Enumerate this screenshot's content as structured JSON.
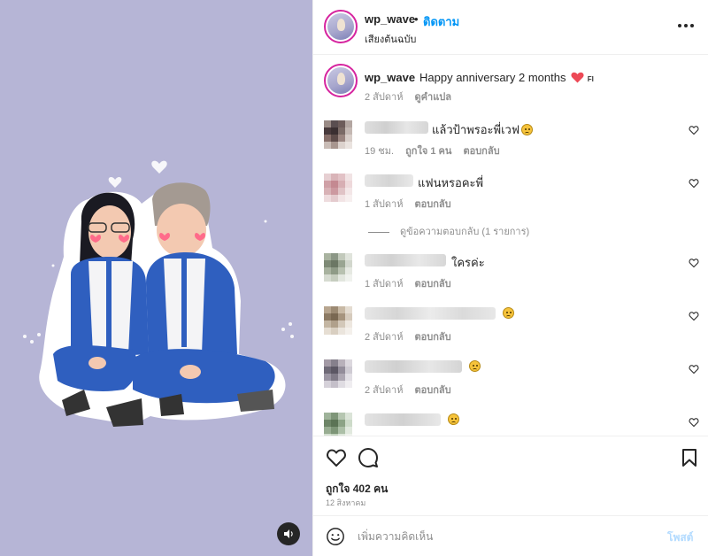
{
  "header": {
    "username": "wp_wave",
    "separator": "•",
    "follow_label": "ติดตาม",
    "sound_label": "เสียงต้นฉบับ",
    "more_icon": "more-horizontal-icon"
  },
  "caption": {
    "username": "wp_wave",
    "text": "Happy anniversary 2 months",
    "suffix": "FI",
    "time": "2 สัปดาห์",
    "translate_label": "ดูคำแปล"
  },
  "comments": [
    {
      "text": "แล้วป้าพรอะพี่เวฟ",
      "has_emoji": true,
      "time": "19 ชม.",
      "likes": "ถูกใจ 1 คน",
      "reply": "ตอบกลับ"
    },
    {
      "text": "แฟนหรอคะพี่",
      "has_emoji": false,
      "time": "1 สัปดาห์",
      "likes": "",
      "reply": "ตอบกลับ"
    },
    {
      "text": "ใครค่ะ",
      "has_emoji": false,
      "time": "1 สัปดาห์",
      "likes": "",
      "reply": "ตอบกลับ"
    },
    {
      "text": "",
      "has_emoji": true,
      "time": "2 สัปดาห์",
      "likes": "",
      "reply": "ตอบกลับ"
    },
    {
      "text": "",
      "has_emoji": true,
      "time": "2 สัปดาห์",
      "likes": "",
      "reply": "ตอบกลับ"
    },
    {
      "text": "",
      "has_emoji": true,
      "time": "",
      "likes": "",
      "reply": ""
    }
  ],
  "view_replies": "ดูข้อความตอบกลับ (1 รายการ)",
  "actions": {
    "likes_text": "ถูกใจ 402 คน",
    "date": "12 สิงหาคม"
  },
  "add_comment": {
    "placeholder": "เพิ่มความคิดเห็น",
    "post_label": "โพสต์"
  },
  "colors": {
    "accent": "#0095f6",
    "media_bg": "#b6b5d6",
    "heart": "#ed4956",
    "post_disabled": "#b3dbff"
  }
}
